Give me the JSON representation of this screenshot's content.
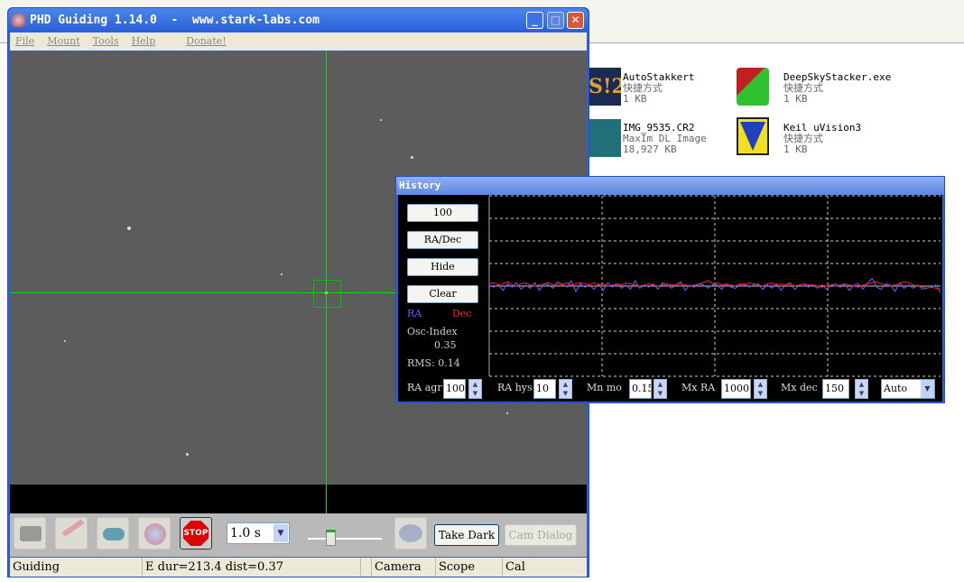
{
  "phd": {
    "title": "PHD Guiding 1.14.0  -  www.stark-labs.com",
    "menu": [
      "File",
      "Mount",
      "Tools",
      "Help",
      "Donate!"
    ],
    "toolbar": {
      "exposure": "1.0 s",
      "take_dark": "Take Dark",
      "cam_dialog": "Cam Dialog",
      "stop": "STOP"
    },
    "status": {
      "state": "Guiding",
      "info": "E dur=213.4 dist=0.37",
      "camera": "Camera",
      "scope": "Scope",
      "cal": "Cal"
    },
    "crosshair_color": "#00ff00"
  },
  "history": {
    "title": "History",
    "buttons": [
      "100",
      "RA/Dec",
      "Hide",
      "Clear"
    ],
    "legend": {
      "ra": "RA",
      "dec": "Dec",
      "ra_color": "#6060ff",
      "dec_color": "#ff2020"
    },
    "osc_label": "Osc-Index",
    "osc_value": "0.35",
    "rms": "RMS: 0.14",
    "controls": {
      "ra_agr_label": "RA agr",
      "ra_agr": "100",
      "ra_hys_label": "RA hys",
      "ra_hys": "10",
      "mn_mo_label": "Mn mo",
      "mn_mo": "0.15",
      "mx_ra_label": "Mx RA",
      "mx_ra": "1000",
      "mx_dec_label": "Mx dec",
      "mx_dec": "150",
      "mode": "Auto"
    },
    "graph": {
      "ra": [
        0.05,
        -0.1,
        0.1,
        -0.4,
        0.2,
        -0.1,
        0.3,
        -0.3,
        0.1,
        -0.2,
        0.3,
        -0.4,
        0.2,
        0.1,
        -0.2,
        0.4,
        0.2,
        -0.1,
        0.5,
        -0.5,
        0.2,
        -0.1,
        0.1,
        -0.3,
        0.2,
        -0.4,
        0.3,
        -0.1,
        0.2,
        -0.2,
        0.1,
        -0.3,
        0.5,
        -0.2,
        0.1,
        -0.1,
        0.2,
        -0.3,
        0.3,
        0.1,
        -0.2,
        0.1,
        0.4,
        -0.4,
        0.1,
        -0.1,
        0.2,
        0.1,
        -0.2,
        0.1,
        0.1,
        -0.3,
        0.2,
        -0.1,
        -0.2,
        0.1,
        0.2,
        -0.1,
        0.1,
        0.2,
        -0.3,
        0.1,
        -0.2,
        0.2,
        -0.4,
        0.1,
        0.3,
        -0.3,
        0.1,
        0.2,
        -0.1,
        0.1,
        -0.2,
        0.1,
        -0.3,
        0.1,
        0.2,
        -0.1,
        0.2,
        -0.4,
        0.1,
        0.2,
        -0.3,
        0.3,
        0.7,
        -0.1,
        -0.3,
        0.2,
        0.1,
        -0.5,
        0.3,
        -0.2,
        0.1,
        -0.2,
        0.1,
        -0.3,
        -0.2,
        -0.1,
        0.1,
        -0.6
      ],
      "dec": [
        0.2,
        0.3,
        0.1,
        0.2,
        0.4,
        0.1,
        0.0,
        0.2,
        0.3,
        0.1,
        0.0,
        0.1,
        0.2,
        0.3,
        0.1,
        0.2,
        0.1,
        0.3,
        0.1,
        0.2,
        0.3,
        0.2,
        0.1,
        0.3,
        0.1,
        0.2,
        0.0,
        0.1,
        0.2,
        0.1,
        0.3,
        0.2,
        0.1,
        0.0,
        0.1,
        0.2,
        0.1,
        0.0,
        0.1,
        0.2,
        0.1,
        0.1,
        0.2,
        0.1,
        0.0,
        0.1,
        0.2,
        0.3,
        0.5,
        0.2,
        0.3,
        0.1,
        0.2,
        0.1,
        0.0,
        0.2,
        0.1,
        0.3,
        0.2,
        0.1,
        0.0,
        0.2,
        0.3,
        0.1,
        0.2,
        0.1,
        0.2,
        0.0,
        0.1,
        0.2,
        0.1,
        0.1,
        0.0,
        -0.1,
        0.0,
        0.1,
        0.0,
        0.1,
        0.2,
        0.1,
        0.0,
        -0.1,
        0.1,
        0.2,
        0.3,
        0.4,
        0.2,
        0.1,
        0.0,
        0.1,
        0.2,
        0.4,
        0.3,
        0.1,
        0.0,
        -0.1,
        -0.2,
        -0.1,
        -0.2,
        -0.3
      ]
    }
  },
  "explorer": {
    "files": [
      {
        "name": "AutoStakkert",
        "type": "快捷方式",
        "size": "1 KB"
      },
      {
        "name": "DeepSkyStacker.exe",
        "type": "快捷方式",
        "size": "1 KB"
      },
      {
        "name": "IMG_9535.CR2",
        "type": "MaxIm DL Image",
        "size": "18,927 KB"
      },
      {
        "name": "Keil uVision3",
        "type": "快捷方式",
        "size": "1 KB"
      }
    ]
  }
}
